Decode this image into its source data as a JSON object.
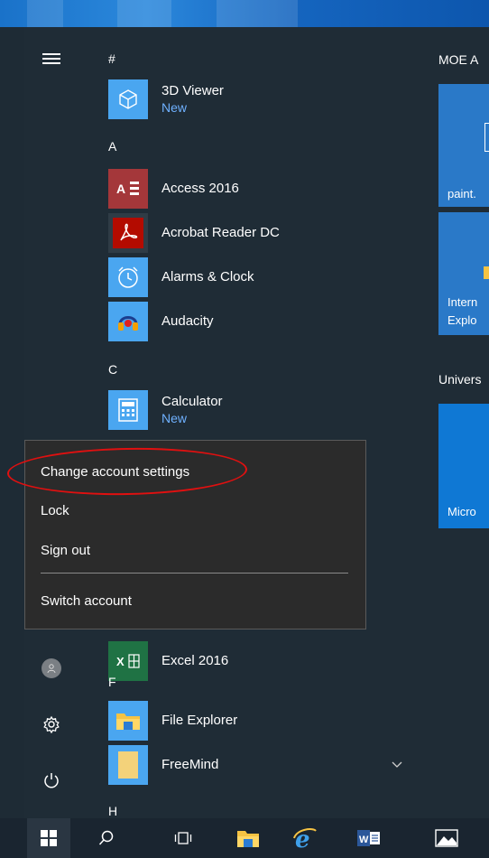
{
  "tiles_section": {
    "heading_1": "MOE A",
    "heading_2": "Univers",
    "tile_paint": "paint.",
    "tile_ie_line1": "Intern",
    "tile_ie_line2": "Explo",
    "tile_micro": "Micro"
  },
  "app_list": {
    "letters": {
      "hash": "#",
      "a": "A",
      "c": "C",
      "f": "F",
      "h": "H"
    },
    "apps": [
      {
        "name": "3D Viewer",
        "sub": "New"
      },
      {
        "name": "Access 2016"
      },
      {
        "name": "Acrobat Reader DC"
      },
      {
        "name": "Alarms & Clock"
      },
      {
        "name": "Audacity"
      },
      {
        "name": "Calculator",
        "sub": "New"
      },
      {
        "name": "Excel 2016"
      },
      {
        "name": "File Explorer"
      },
      {
        "name": "FreeMind"
      }
    ]
  },
  "account_menu": {
    "items": [
      {
        "label": "Change account settings"
      },
      {
        "label": "Lock"
      },
      {
        "label": "Sign out"
      },
      {
        "label": "Switch account"
      }
    ]
  },
  "colors": {
    "accent": "#2a79c8",
    "highlight_ring": "#e01010",
    "start_bg": "#1f2c36",
    "menu_bg": "#2b2b2b"
  },
  "icons": {
    "rail": [
      "hamburger-icon",
      "user-avatar-icon",
      "settings-gear-icon",
      "power-icon"
    ],
    "taskbar": [
      "windows-start-icon",
      "search-icon",
      "task-view-icon",
      "file-explorer-icon",
      "internet-explorer-icon",
      "word-icon",
      "photos-icon"
    ]
  }
}
